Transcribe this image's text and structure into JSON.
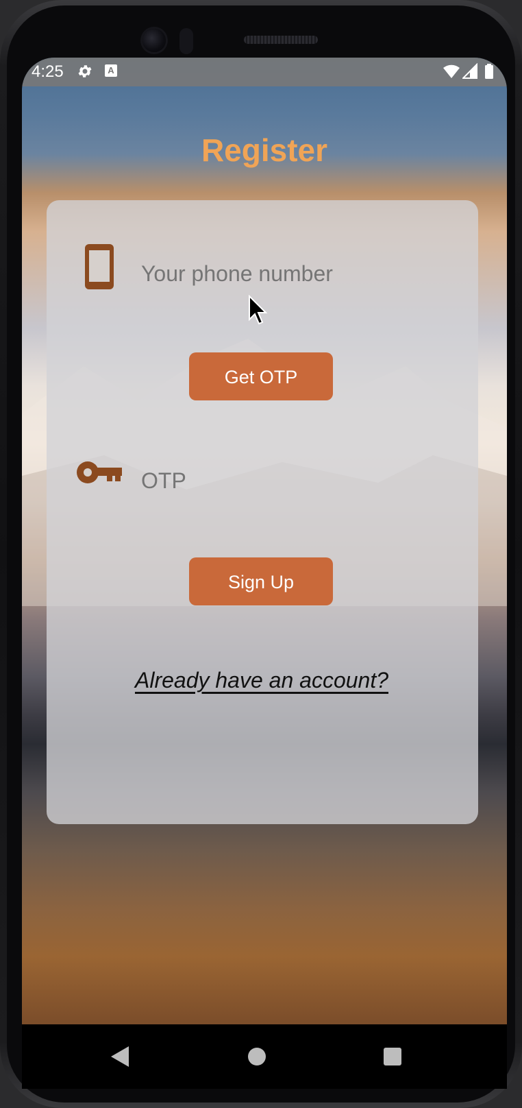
{
  "status_bar": {
    "time": "4:25",
    "icons": [
      "gear-icon",
      "a-icon",
      "wifi-icon",
      "signal-icon",
      "battery-icon"
    ]
  },
  "page": {
    "title": "Register"
  },
  "form": {
    "phone": {
      "icon": "phone-icon",
      "placeholder": "Your phone number",
      "value": ""
    },
    "get_otp_label": "Get OTP",
    "otp": {
      "icon": "key-icon",
      "placeholder": "OTP",
      "value": ""
    },
    "signup_label": "Sign Up",
    "login_link": "Already have an account?"
  },
  "nav_bar": {
    "icons": [
      "back-icon",
      "home-icon",
      "recents-icon"
    ]
  },
  "colors": {
    "title": "#f0a456",
    "button": "#c9693a",
    "icon": "#8b4a1f",
    "card": "rgba(210,210,214,0.78)"
  }
}
